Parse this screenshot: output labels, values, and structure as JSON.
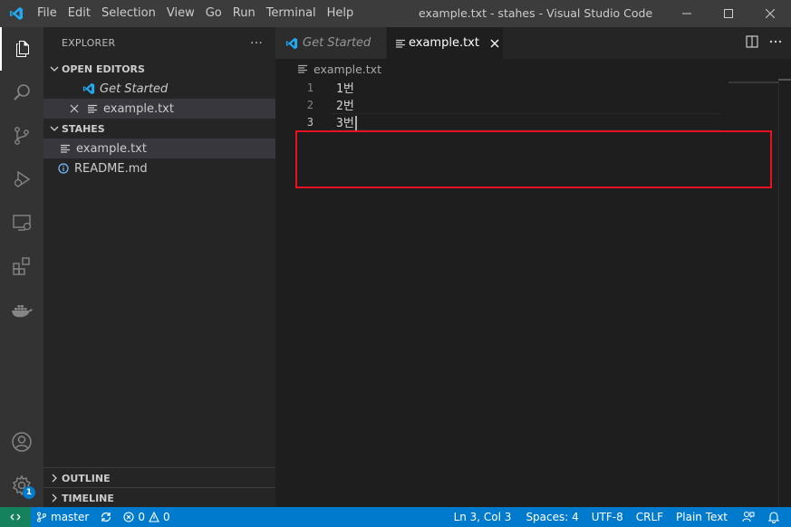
{
  "titlebar": {
    "menu": [
      "File",
      "Edit",
      "Selection",
      "View",
      "Go",
      "Run",
      "Terminal",
      "Help"
    ],
    "title": "example.txt - stahes - Visual Studio Code"
  },
  "activitybar": {
    "icons": [
      "explorer-icon",
      "search-icon",
      "source-control-icon",
      "run-debug-icon",
      "remote-explorer-icon",
      "extensions-icon",
      "docker-icon",
      "account-icon",
      "settings-gear-icon"
    ],
    "settings_badge": "1"
  },
  "sidebar": {
    "title": "EXPLORER",
    "more": "···",
    "open_editors": {
      "label": "OPEN EDITORS",
      "items": [
        {
          "label": "Get Started"
        },
        {
          "label": "example.txt"
        }
      ]
    },
    "folder": {
      "label": "STAHES",
      "files": [
        {
          "label": "example.txt"
        },
        {
          "label": "README.md"
        }
      ]
    },
    "outline": "OUTLINE",
    "timeline": "TIMELINE"
  },
  "tabs": [
    {
      "label": "Get Started",
      "active": false
    },
    {
      "label": "example.txt",
      "active": true
    }
  ],
  "breadcrumb": "example.txt",
  "editor": {
    "lines": [
      {
        "number": "1",
        "text": "1번"
      },
      {
        "number": "2",
        "text": "2번"
      },
      {
        "number": "3",
        "text": "3번"
      }
    ],
    "current_line": 3
  },
  "statusbar": {
    "branch": "master",
    "errors": "0",
    "warnings": "0",
    "position": "Ln 3, Col 3",
    "spaces": "Spaces: 4",
    "encoding": "UTF-8",
    "eol": "CRLF",
    "language": "Plain Text"
  },
  "colors": {
    "accent": "#007acc",
    "remote": "#16825d",
    "highlight_box": "#e81123",
    "vscode_blue": "#23a9f2"
  }
}
